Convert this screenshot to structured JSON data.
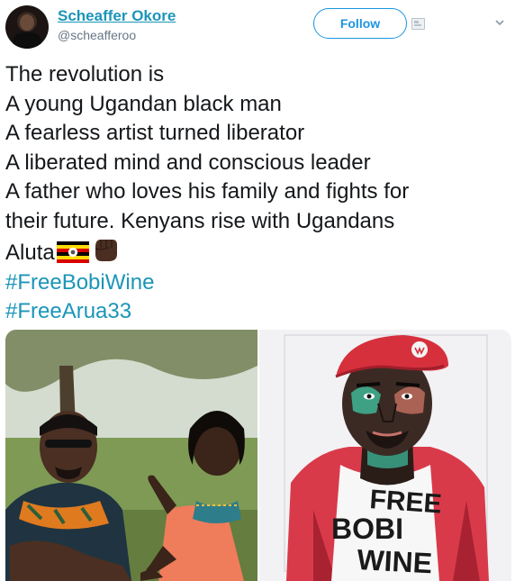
{
  "header": {
    "display_name": "Scheaffer Okore",
    "handle": "@scheafferoo",
    "follow_label": "Follow",
    "ad_icon": "ad-info-icon",
    "menu_icon": "chevron-down-icon",
    "accent_color": "#1b95b8"
  },
  "tweet": {
    "lines": [
      "The revolution is",
      "A young Ugandan black man",
      "A fearless artist turned liberator",
      "A liberated mind and conscious leader",
      "A father who loves his family and fights for",
      "their future. Kenyans rise with Ugandans",
      "Aluta"
    ],
    "emojis": [
      "flag-uganda-icon",
      "raised-fist-icon"
    ],
    "hashtags": [
      "#FreeBobiWine",
      "#FreeArua33"
    ]
  },
  "media": {
    "left_image": "photo of a man and a young child outdoors",
    "right_image_shirt_text": [
      "FREE",
      "BOBI",
      "WINE"
    ]
  }
}
